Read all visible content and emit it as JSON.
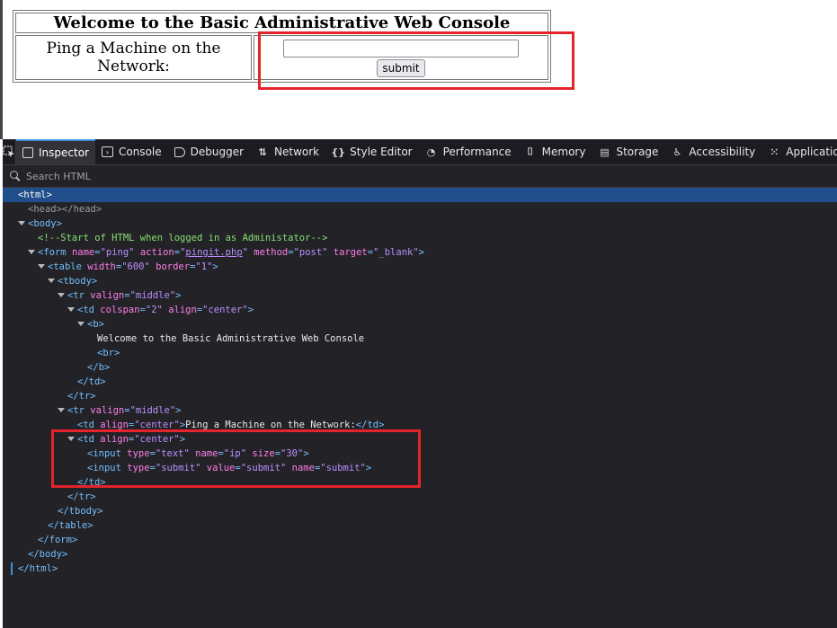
{
  "page": {
    "title": "Welcome to the Basic Administrative Web Console",
    "ping_label": "Ping a Machine on the Network:",
    "ip_value": "",
    "submit_label": "submit"
  },
  "devtools": {
    "tabs": [
      {
        "label": "Inspector",
        "icon": "inspector-icon"
      },
      {
        "label": "Console",
        "icon": "console-icon"
      },
      {
        "label": "Debugger",
        "icon": "debugger-icon"
      },
      {
        "label": "Network",
        "icon": "network-icon"
      },
      {
        "label": "Style Editor",
        "icon": "style-editor-icon"
      },
      {
        "label": "Performance",
        "icon": "performance-icon"
      },
      {
        "label": "Memory",
        "icon": "memory-icon"
      },
      {
        "label": "Storage",
        "icon": "storage-icon"
      },
      {
        "label": "Accessibility",
        "icon": "accessibility-icon"
      },
      {
        "label": "Applicatio",
        "icon": "application-icon"
      }
    ],
    "search_placeholder": "Search HTML",
    "comment": "<!--Start of HTML when logged in as Administator-->",
    "form_action": "pingit.php",
    "welcome_text": "Welcome to the Basic Administrative Web Console",
    "ping_td_text": "Ping a Machine on the Network:"
  },
  "colors": {
    "highlight": "#e4232b",
    "selected_row": "#204e8a",
    "tag": "#75bfff",
    "attr_name": "#ff7de9",
    "attr_value": "#b98eff",
    "comment": "#86de74"
  }
}
